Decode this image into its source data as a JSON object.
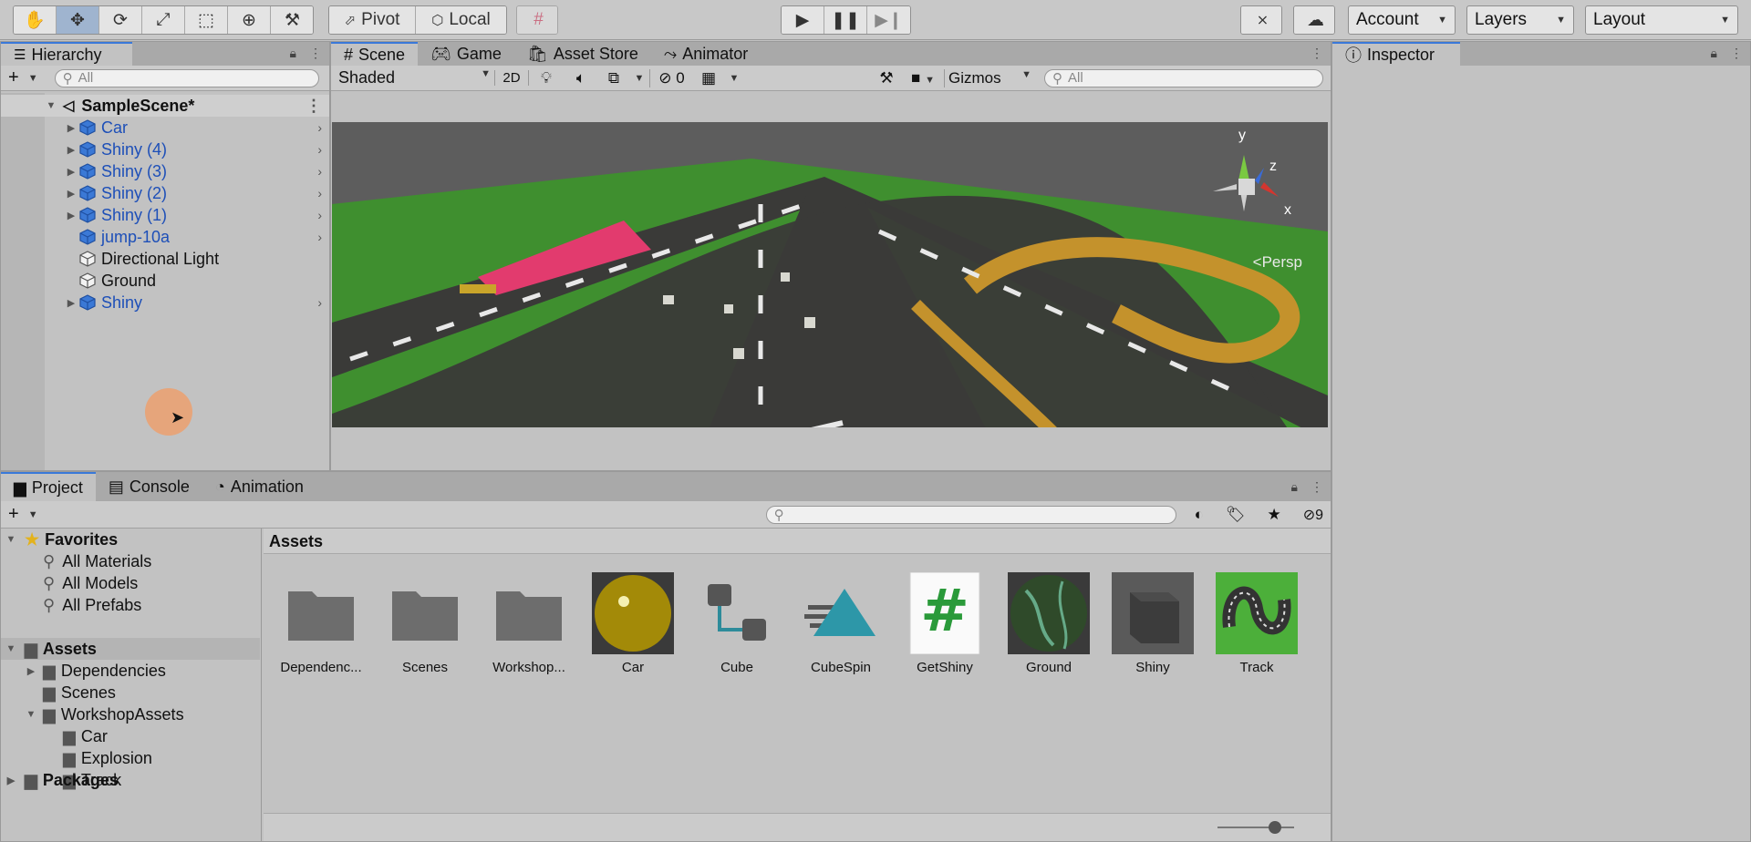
{
  "toolbar": {
    "tools": [
      "hand-tool",
      "move-tool",
      "rotate-tool",
      "scale-tool",
      "rect-tool",
      "transform-tool",
      "custom-tool"
    ],
    "pivot_label": "Pivot",
    "local_label": "Local",
    "account_label": "Account",
    "layers_label": "Layers",
    "layout_label": "Layout"
  },
  "hierarchy": {
    "tab_label": "Hierarchy",
    "search_placeholder": "All",
    "scene_name": "SampleScene*",
    "items": [
      {
        "label": "Car",
        "prefab": true,
        "expandable": true
      },
      {
        "label": "Shiny (4)",
        "prefab": true,
        "expandable": true
      },
      {
        "label": "Shiny (3)",
        "prefab": true,
        "expandable": true
      },
      {
        "label": "Shiny (2)",
        "prefab": true,
        "expandable": true
      },
      {
        "label": "Shiny (1)",
        "prefab": true,
        "expandable": true
      },
      {
        "label": "jump-10a",
        "prefab": true,
        "expandable": false
      },
      {
        "label": "Directional Light",
        "prefab": false,
        "expandable": false
      },
      {
        "label": "Ground",
        "prefab": false,
        "expandable": false
      },
      {
        "label": "Shiny",
        "prefab": true,
        "expandable": true
      }
    ]
  },
  "scene": {
    "tabs": [
      "Scene",
      "Game",
      "Asset Store",
      "Animator"
    ],
    "shading_mode": "Shaded",
    "mode_2d": "2D",
    "hidden_count": "0",
    "gizmos_label": "Gizmos",
    "search_placeholder": "All",
    "persp_label": "Persp",
    "axis_y": "y",
    "axis_z": "z",
    "axis_x": "x"
  },
  "inspector": {
    "tab_label": "Inspector"
  },
  "project": {
    "tabs": [
      "Project",
      "Console",
      "Animation"
    ],
    "hidden_count": "9",
    "favorites_label": "Favorites",
    "favorites": [
      "All Materials",
      "All Models",
      "All Prefabs"
    ],
    "assets_label": "Assets",
    "asset_folders": [
      "Dependencies",
      "Scenes",
      "WorkshopAssets"
    ],
    "workshop_subfolders": [
      "Car",
      "Explosion",
      "Track"
    ],
    "packages_label": "Packages",
    "breadcrumb": "Assets",
    "grid_items": [
      "Dependenc...",
      "Scenes",
      "Workshop...",
      "Car",
      "Cube",
      "CubeSpin",
      "GetShiny",
      "Ground",
      "Shiny",
      "Track"
    ]
  },
  "colors": {
    "accent": "#3a79d9",
    "prefab_text": "#1d4fb8",
    "panel_bg": "#c2c2c2",
    "grass": "#3f8f2f",
    "asphalt": "#3a3a38"
  }
}
